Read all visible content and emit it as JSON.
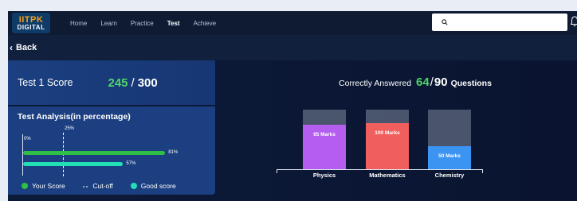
{
  "nav": {
    "logo_top": "IITPK",
    "logo_bottom": "DIGITAL",
    "links": [
      "Home",
      "Learn",
      "Practice",
      "Test",
      "Achieve"
    ],
    "active": "Test",
    "search_placeholder": ""
  },
  "back_label": "Back",
  "score": {
    "title": "Test 1 Score",
    "value": "245",
    "separator": "/",
    "total": "300"
  },
  "analysis": {
    "title": "Test Analysis(in percentage)",
    "zero_label": "0%",
    "cutoff_label": "25%",
    "your_score_pct": 81,
    "your_score_label": "81%",
    "good_score_pct": 57,
    "good_score_label": "57%",
    "legend": {
      "your_score": "Your Score",
      "cutoff": "Cut-off",
      "good_score": "Good score"
    }
  },
  "correct": {
    "prefix": "Correctly Answered",
    "value": "64",
    "separator": "/",
    "total": "90",
    "suffix": "Questions"
  },
  "subjects": [
    {
      "name": "Physics",
      "marks_label": "95 Marks",
      "marks": 95
    },
    {
      "name": "Mathematics",
      "marks_label": "100 Marks",
      "marks": 100
    },
    {
      "name": "Chemistry",
      "marks_label": "50 Marks",
      "marks": 50
    }
  ],
  "colors": {
    "your_score": "#2fbf47",
    "good_score": "#23dfb6",
    "physics": "#b45ef0",
    "mathematics": "#f15e5e",
    "chemistry": "#3b93f2",
    "accent_green": "#52d36b"
  }
}
